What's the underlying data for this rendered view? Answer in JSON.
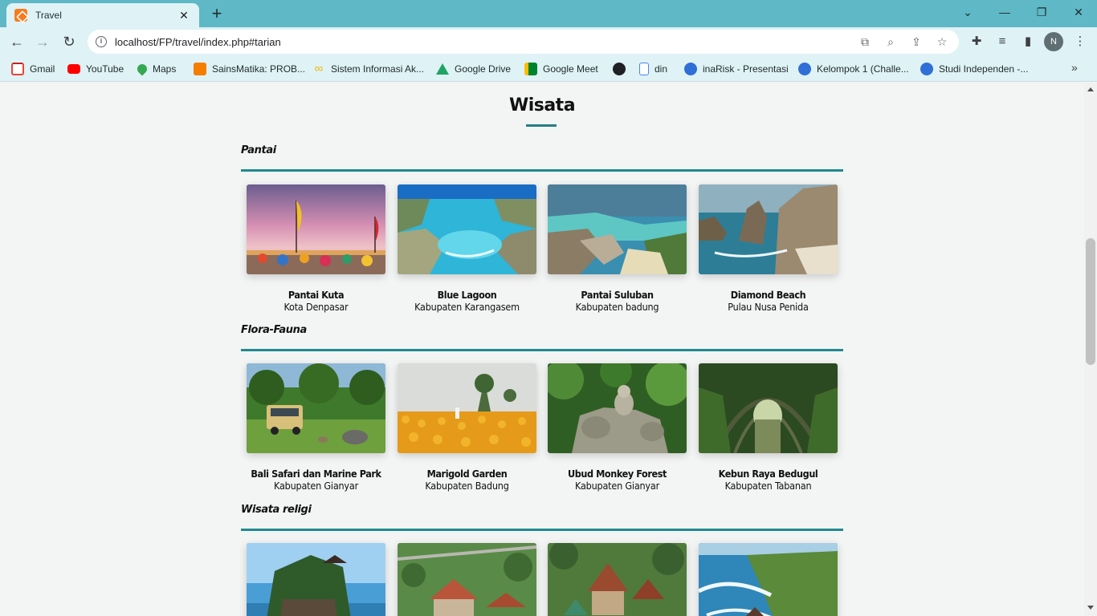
{
  "browser": {
    "tab_title": "Travel",
    "url": "localhost/FP/travel/index.php#tarian",
    "profile_initial": "N",
    "bookmarks": [
      {
        "label": "Gmail",
        "icon": "gmail-icon",
        "color": "#ea4335"
      },
      {
        "label": "YouTube",
        "icon": "youtube-icon",
        "color": "#ff0000"
      },
      {
        "label": "Maps",
        "icon": "maps-icon",
        "color": "#34a853"
      },
      {
        "label": "SainsMatika: PROB...",
        "icon": "blogger-icon",
        "color": "#f57d00"
      },
      {
        "label": "Sistem Informasi Ak...",
        "icon": "infinity-icon",
        "color": "#f2b705"
      },
      {
        "label": "Google Drive",
        "icon": "drive-icon",
        "color": "#1fa463"
      },
      {
        "label": "Google Meet",
        "icon": "meet-icon",
        "color": "#00832d"
      },
      {
        "label": "",
        "icon": "globe-icon",
        "color": "#202124"
      },
      {
        "label": "din",
        "icon": "document-icon",
        "color": "#4285f4"
      },
      {
        "label": "inaRisk - Presentasi",
        "icon": "canva-icon",
        "color": "#2f6fd6"
      },
      {
        "label": "Kelompok 1 (Challe...",
        "icon": "canva-icon",
        "color": "#2f6fd6"
      },
      {
        "label": "Studi Independen -...",
        "icon": "canva-icon",
        "color": "#2f6fd6"
      }
    ]
  },
  "page": {
    "heading": "Wisata",
    "accent_color": "#1f8a8f",
    "categories": [
      {
        "title": "Pantai",
        "items": [
          {
            "name": "Pantai Kuta",
            "location": "Kota Denpasar",
            "image": "beach-sunset-photo"
          },
          {
            "name": "Blue Lagoon",
            "location": "Kabupaten Karangasem",
            "image": "lagoon-photo"
          },
          {
            "name": "Pantai Suluban",
            "location": "Kabupaten badung",
            "image": "rocky-beach-photo"
          },
          {
            "name": "Diamond Beach",
            "location": "Pulau Nusa Penida",
            "image": "cliff-beach-photo"
          }
        ]
      },
      {
        "title": "Flora-Fauna",
        "items": [
          {
            "name": "Bali Safari dan Marine Park",
            "location": "Kabupaten Gianyar",
            "image": "safari-photo"
          },
          {
            "name": "Marigold Garden",
            "location": "Kabupaten Badung",
            "image": "marigold-photo"
          },
          {
            "name": "Ubud Monkey Forest",
            "location": "Kabupaten Gianyar",
            "image": "monkey-forest-photo"
          },
          {
            "name": "Kebun Raya Bedugul",
            "location": "Kabupaten Tabanan",
            "image": "botanical-garden-photo"
          }
        ]
      },
      {
        "title": "Wisata religi",
        "items": [
          {
            "name": "",
            "location": "",
            "image": "sea-temple-photo"
          },
          {
            "name": "",
            "location": "",
            "image": "temple-aerial-photo"
          },
          {
            "name": "",
            "location": "",
            "image": "temple-roofs-photo"
          },
          {
            "name": "",
            "location": "",
            "image": "cliff-temple-photo"
          }
        ]
      }
    ]
  }
}
